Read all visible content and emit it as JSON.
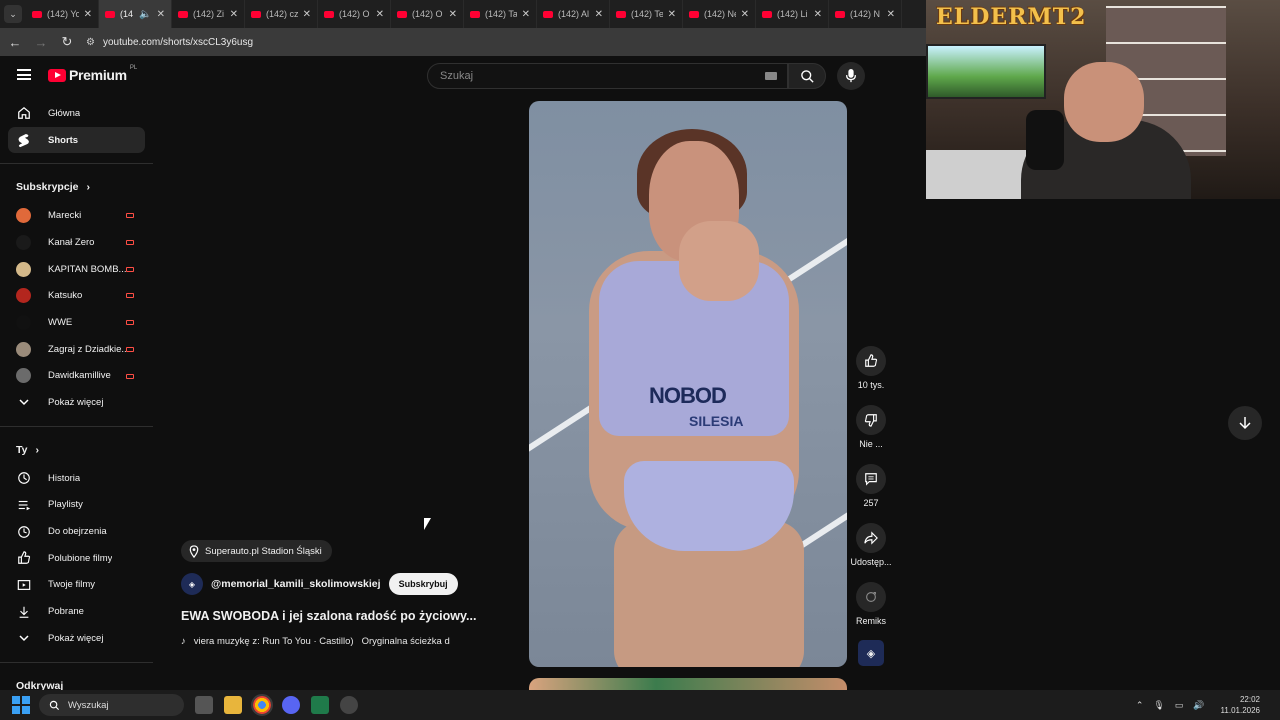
{
  "browser": {
    "tabs": [
      {
        "title": "(142) Yo"
      },
      {
        "title": "(14"
      },
      {
        "title": "(142) Zi"
      },
      {
        "title": "(142) cz"
      },
      {
        "title": "(142) O"
      },
      {
        "title": "(142) O"
      },
      {
        "title": "(142) Ta"
      },
      {
        "title": "(142) Al"
      },
      {
        "title": "(142) Te"
      },
      {
        "title": "(142) Ne"
      },
      {
        "title": "(142) Li"
      },
      {
        "title": "(142) N"
      }
    ],
    "url": "youtube.com/shorts/xscCL3y6usg"
  },
  "masthead": {
    "logo": "Premium",
    "country": "PL",
    "search_placeholder": "Szukaj"
  },
  "sidebar": {
    "main": [
      {
        "label": "Główna",
        "icon": "home-icon"
      },
      {
        "label": "Shorts",
        "icon": "shorts-icon"
      }
    ],
    "subscriptions_heading": "Subskrypcje",
    "subscriptions": [
      {
        "label": "Marecki",
        "color": "#e0693a"
      },
      {
        "label": "Kanał Zero",
        "color": "#1a1a1a"
      },
      {
        "label": "KAPITAN BOMB...",
        "color": "#d4b98a"
      },
      {
        "label": "Katsuko",
        "color": "#b3261e"
      },
      {
        "label": "WWE",
        "color": "#111111"
      },
      {
        "label": "Zagraj z Dziadkie...",
        "color": "#9a8b7a"
      },
      {
        "label": "Dawidkamillive",
        "color": "#6b6b6b"
      }
    ],
    "show_more_1": "Pokaż więcej",
    "you_heading": "Ty",
    "you": [
      {
        "label": "Historia",
        "icon": "history-icon"
      },
      {
        "label": "Playlisty",
        "icon": "playlist-icon"
      },
      {
        "label": "Do obejrzenia",
        "icon": "clock-icon"
      },
      {
        "label": "Polubione filmy",
        "icon": "thumb-up-icon"
      },
      {
        "label": "Twoje filmy",
        "icon": "video-icon"
      },
      {
        "label": "Pobrane",
        "icon": "download-icon"
      }
    ],
    "show_more_2": "Pokaż więcej",
    "explore_heading": "Odkrywaj"
  },
  "short": {
    "location": "Superauto.pl Stadion Śląski",
    "channel": "@memorial_kamili_skolimowskiej",
    "subscribe": "Subskrybuj",
    "title": "EWA SWOBODA i jej szalona radość po życiowy...",
    "music_text": "viera muzykę z: Run To You · Castillo)",
    "music_text2": "Oryginalna ścieżka d",
    "bib_text": "NOBOD",
    "bib_sub": "SILESIA"
  },
  "actions": {
    "likes": "10 tys.",
    "dislike": "Nie ...",
    "comments": "257",
    "share": "Udostęp...",
    "remix": "Remiks"
  },
  "stream_overlay": {
    "logo": "ELDERMT2"
  },
  "taskbar": {
    "search": "Wyszukaj",
    "time": "22:02",
    "date": "11.01.2026"
  }
}
